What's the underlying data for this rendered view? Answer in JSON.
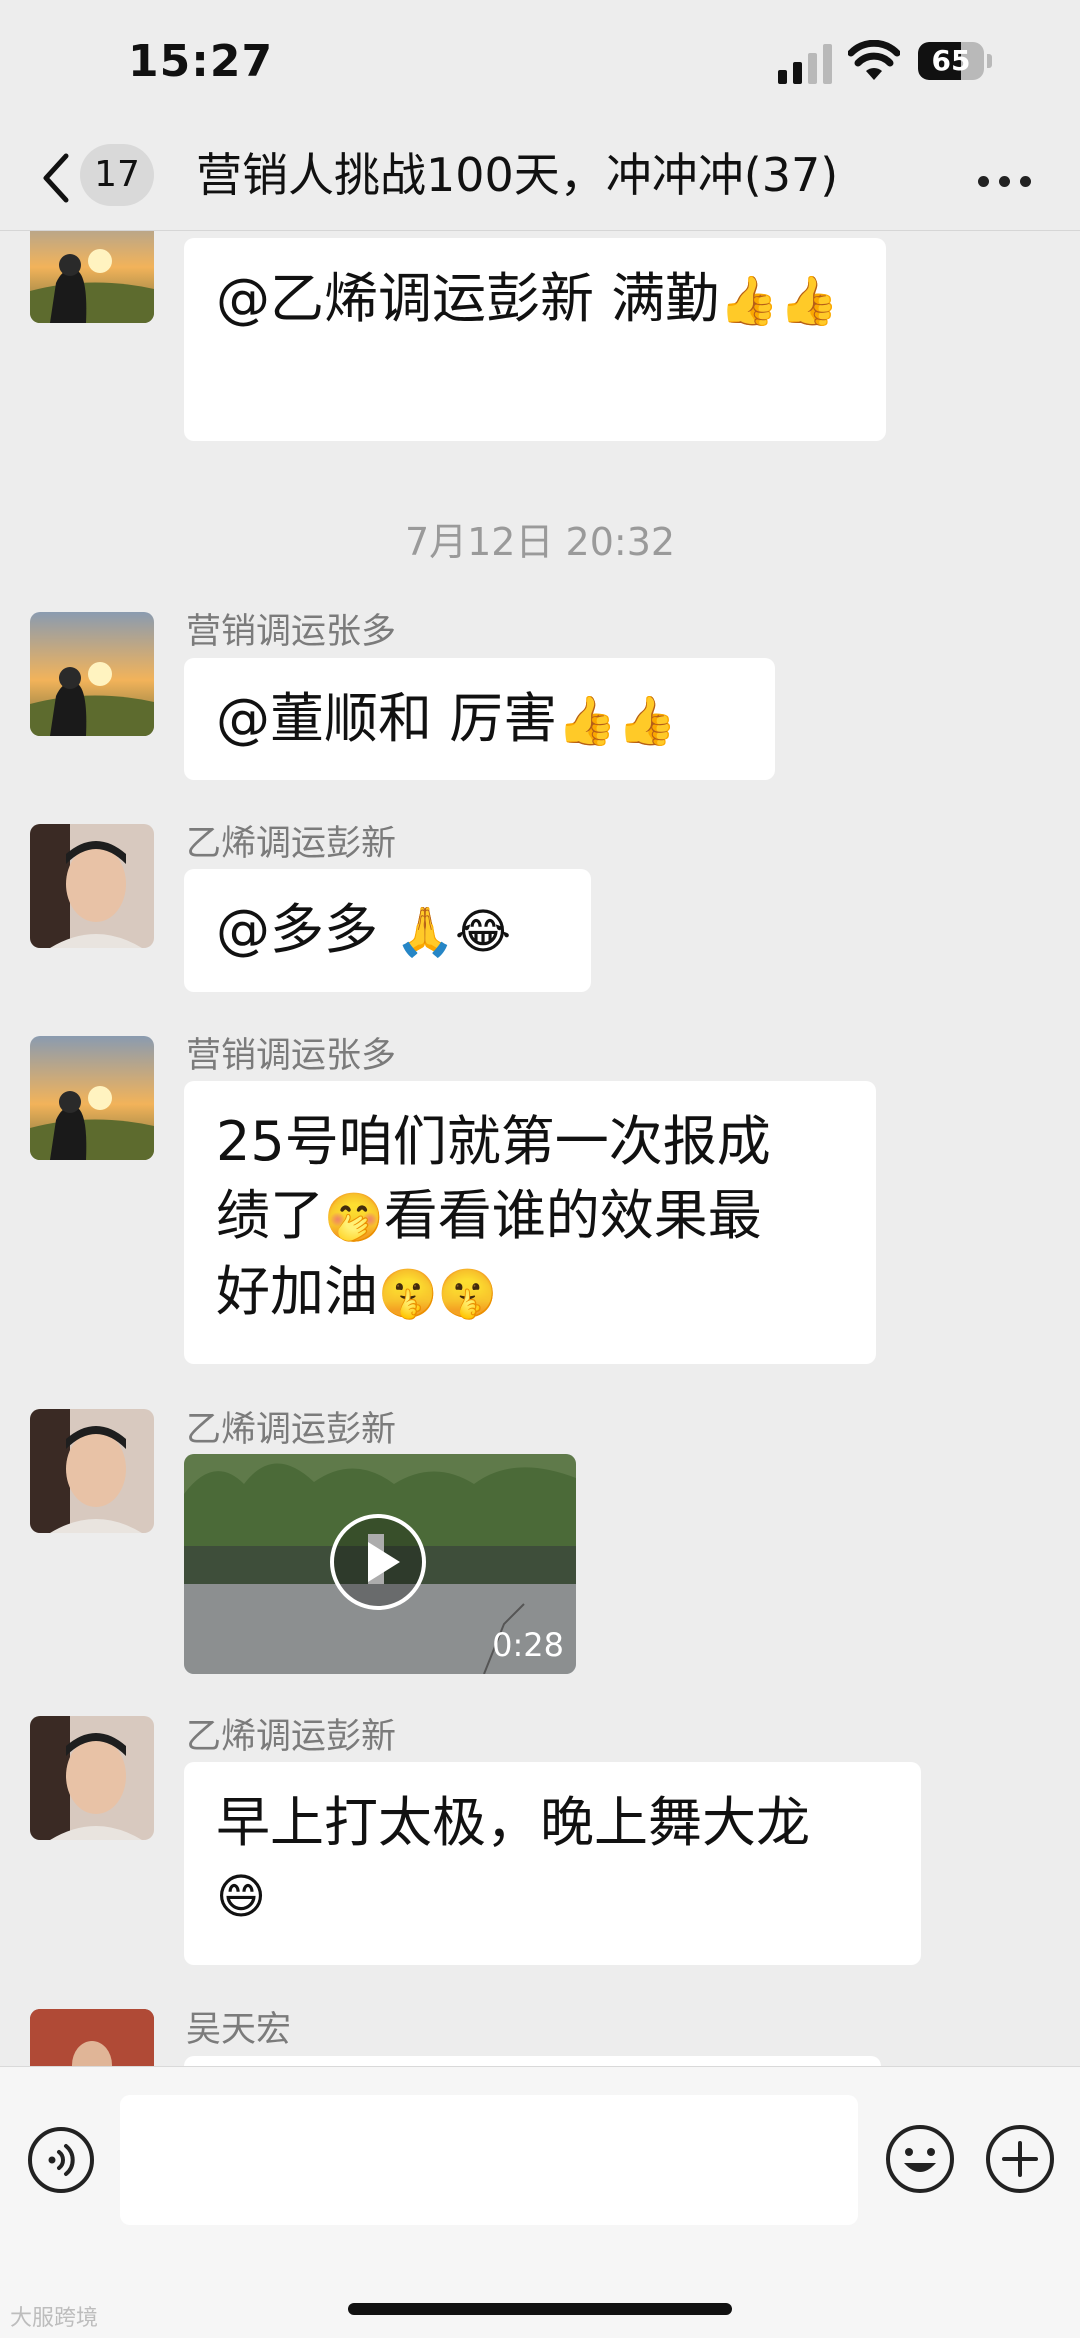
{
  "status": {
    "time": "15:27",
    "battery": "65",
    "battery_level": 0.65
  },
  "nav": {
    "unread": "17",
    "title": "营销人挑战100天，冲冲冲(37)"
  },
  "messages": {
    "m1": {
      "text": "@乙烯调运彭新 满勤",
      "emojis": "👍👍",
      "avatar": "sunset-avatar"
    },
    "ts": "7月12日 20:32",
    "m2": {
      "sender": "营销调运张多",
      "text": "@董顺和 厉害",
      "emojis": "👍👍",
      "avatar": "sunset-avatar"
    },
    "m3": {
      "sender": "乙烯调运彭新",
      "text": "@多多 ",
      "emojis": "🙏😂",
      "avatar": "man-portrait-avatar"
    },
    "m4": {
      "sender": "营销调运张多",
      "line1": "25号咱们就第一次报成",
      "line2a": "绩了",
      "emo2": "🤭",
      "line2b": "看看谁的效果最",
      "line3": "好加油",
      "emo3": "🤫🤫",
      "avatar": "sunset-avatar"
    },
    "m5": {
      "sender": "乙烯调运彭新",
      "video_duration": "0:28",
      "avatar": "man-portrait-avatar"
    },
    "m6": {
      "sender": "乙烯调运彭新",
      "line1": "早上打太极，晚上舞大龙",
      "emo": "😄",
      "avatar": "man-portrait-avatar"
    },
    "m7": {
      "sender": "吴天宏",
      "avatar": "suit-man-avatar"
    }
  },
  "input": {
    "placeholder": ""
  },
  "watermark": "大服跨境",
  "colors": {
    "background": "#ededed",
    "bubble": "#ffffff",
    "sender": "#7b7b7b"
  }
}
